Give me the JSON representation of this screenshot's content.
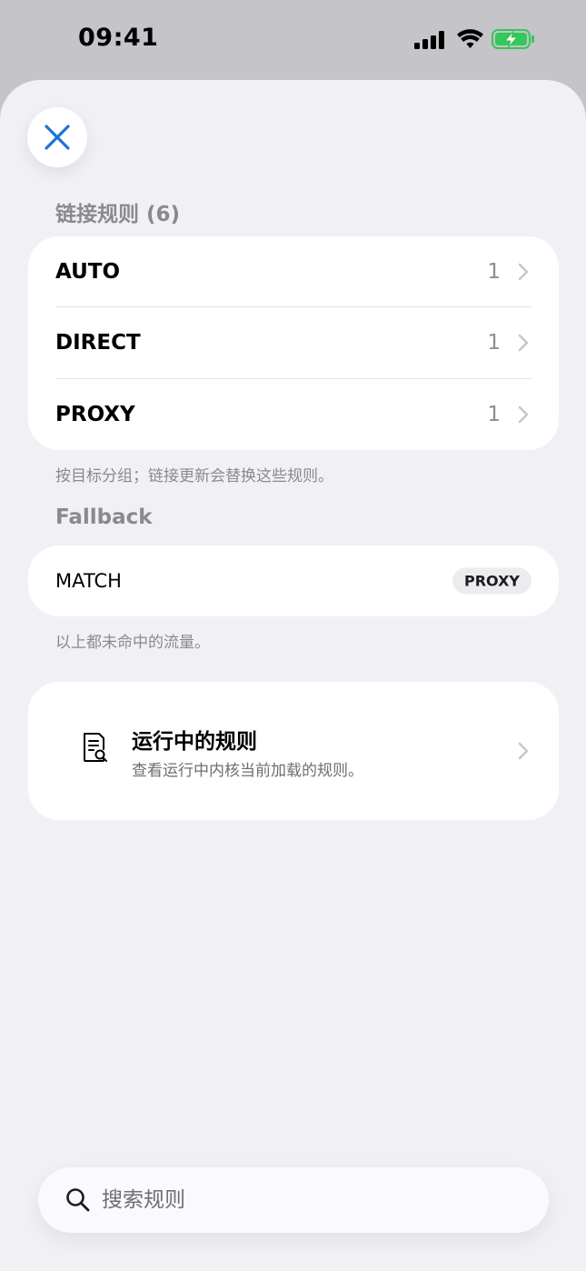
{
  "status_bar": {
    "time": "09:41"
  },
  "sheet": {
    "rules_section": {
      "title": "链接规则 (6)",
      "rows": [
        {
          "label": "AUTO",
          "count": "1"
        },
        {
          "label": "DIRECT",
          "count": "1"
        },
        {
          "label": "PROXY",
          "count": "1"
        }
      ],
      "footnote": "按目标分组；链接更新会替换这些规则。"
    },
    "fallback_section": {
      "title": "Fallback",
      "match_label": "MATCH",
      "match_target": "PROXY",
      "footnote": "以上都未命中的流量。"
    },
    "runtime_card": {
      "title": "运行中的规则",
      "subtitle": "查看运行中内核当前加载的规则。"
    },
    "search": {
      "placeholder": "搜索规则"
    }
  },
  "colors": {
    "accent": "#1a73d9",
    "battery_fill": "#34c759",
    "chevron": "#c7c7cc"
  }
}
